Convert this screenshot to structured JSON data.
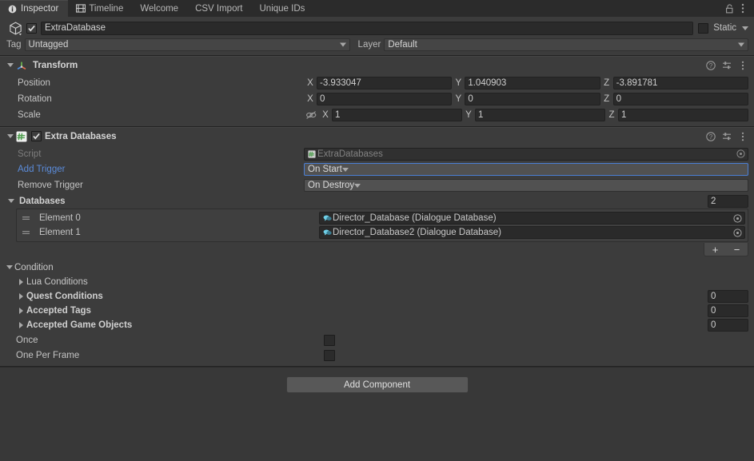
{
  "tabs": [
    {
      "label": "Inspector",
      "icon": "info-icon",
      "active": true
    },
    {
      "label": "Timeline",
      "icon": "film-icon",
      "active": false
    },
    {
      "label": "Welcome",
      "icon": "",
      "active": false
    },
    {
      "label": "CSV Import",
      "icon": "",
      "active": false
    },
    {
      "label": "Unique IDs",
      "icon": "",
      "active": false
    }
  ],
  "window_controls": {
    "lock": "lock-icon",
    "menu": "kebab-menu-icon"
  },
  "gameobject": {
    "icon": "cube-icon",
    "enabled": true,
    "name": "ExtraDatabase",
    "static_label": "Static",
    "static_checked": false,
    "tag_label": "Tag",
    "tag_value": "Untagged",
    "layer_label": "Layer",
    "layer_value": "Default"
  },
  "transform": {
    "title": "Transform",
    "icon": "transform-axis-icon",
    "expanded": true,
    "rows": [
      {
        "label": "Position",
        "x": "-3.933047",
        "y": "1.040903",
        "z": "-3.891781",
        "constrain": false
      },
      {
        "label": "Rotation",
        "x": "0",
        "y": "0",
        "z": "0",
        "constrain": false
      },
      {
        "label": "Scale",
        "x": "1",
        "y": "1",
        "z": "1",
        "constrain": true
      }
    ],
    "axis_labels": [
      "X",
      "Y",
      "Z"
    ],
    "help_icon": "help-icon",
    "preset_icon": "preset-icon",
    "menu_icon": "kebab-menu-icon"
  },
  "extra_databases": {
    "title": "Extra Databases",
    "icon": "cs-script-icon",
    "enabled": true,
    "expanded": true,
    "help_icon": "help-icon",
    "preset_icon": "preset-icon",
    "menu_icon": "kebab-menu-icon",
    "script": {
      "label": "Script",
      "value": "ExtraDatabases",
      "icon": "cs-script-icon",
      "picker": "object-picker-icon"
    },
    "add_trigger": {
      "label": "Add Trigger",
      "value": "On Start",
      "focused": true
    },
    "remove_trigger": {
      "label": "Remove Trigger",
      "value": "On Destroy",
      "focused": false
    },
    "databases": {
      "label": "Databases",
      "expanded": true,
      "size": "2",
      "elements": [
        {
          "label": "Element 0",
          "value": "Director_Database (Dialogue Database)",
          "icon": "dialogue-database-icon",
          "picker": "object-picker-icon"
        },
        {
          "label": "Element 1",
          "value": "Director_Database2 (Dialogue Database)",
          "icon": "dialogue-database-icon",
          "picker": "object-picker-icon"
        }
      ],
      "add_label": "+",
      "remove_label": "−"
    },
    "condition": {
      "label": "Condition",
      "expanded": true,
      "items": [
        {
          "label": "Lua Conditions",
          "expanded": false,
          "bold": false,
          "count": null
        },
        {
          "label": "Quest Conditions",
          "expanded": false,
          "bold": true,
          "count": "0"
        },
        {
          "label": "Accepted Tags",
          "expanded": false,
          "bold": true,
          "count": "0"
        },
        {
          "label": "Accepted Game Objects",
          "expanded": false,
          "bold": true,
          "count": "0"
        }
      ],
      "once": {
        "label": "Once",
        "checked": false
      },
      "one_per_frame": {
        "label": "One Per Frame",
        "checked": false
      }
    }
  },
  "footer": {
    "add_component_label": "Add Component"
  },
  "colors": {
    "background": "#383838",
    "panel": "#3c3c3c",
    "field": "#2a2a2a",
    "accent_link": "#5b8cdb",
    "focus_border": "#4b7fd4",
    "script_green": "#6cba6c"
  }
}
